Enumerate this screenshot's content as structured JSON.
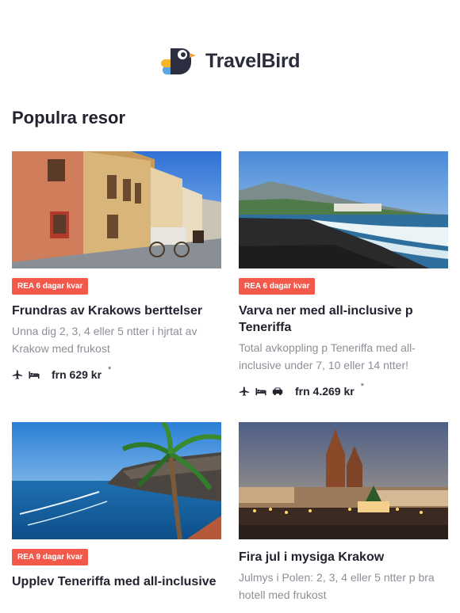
{
  "brand": {
    "name": "TravelBird"
  },
  "section": {
    "title": "Populra resor"
  },
  "cards": [
    {
      "badge": "REA 6 dagar kvar",
      "title": "Frundras av Krakows berttelser",
      "description": "Unna dig 2, 3, 4 eller 5 ntter i hjrtat av Krakow med frukost",
      "price": "frn 629 kr",
      "asterisk": "*",
      "icons": [
        "plane-icon",
        "bed-icon"
      ]
    },
    {
      "badge": "REA 6 dagar kvar",
      "title": "Varva ner med all-inclusive p Teneriffa",
      "description": "Total avkoppling p Teneriffa med all-inclusive under 7, 10 eller 14 ntter!",
      "price": "frn 4.269 kr",
      "asterisk": "*",
      "icons": [
        "plane-icon",
        "bed-icon",
        "car-icon"
      ]
    },
    {
      "badge": "REA 9 dagar kvar",
      "title": "Upplev Teneriffa med all-inclusive",
      "description": "",
      "price": "",
      "asterisk": "",
      "icons": []
    },
    {
      "badge": "",
      "title": "Fira jul i mysiga Krakow",
      "description": "Julmys i Polen: 2, 3, 4 eller 5 ntter p bra hotell med frukost",
      "price": "",
      "asterisk": "",
      "icons": []
    }
  ],
  "colors": {
    "badge": "#f2594b",
    "title": "#23232f",
    "muted": "#8d8f98"
  }
}
